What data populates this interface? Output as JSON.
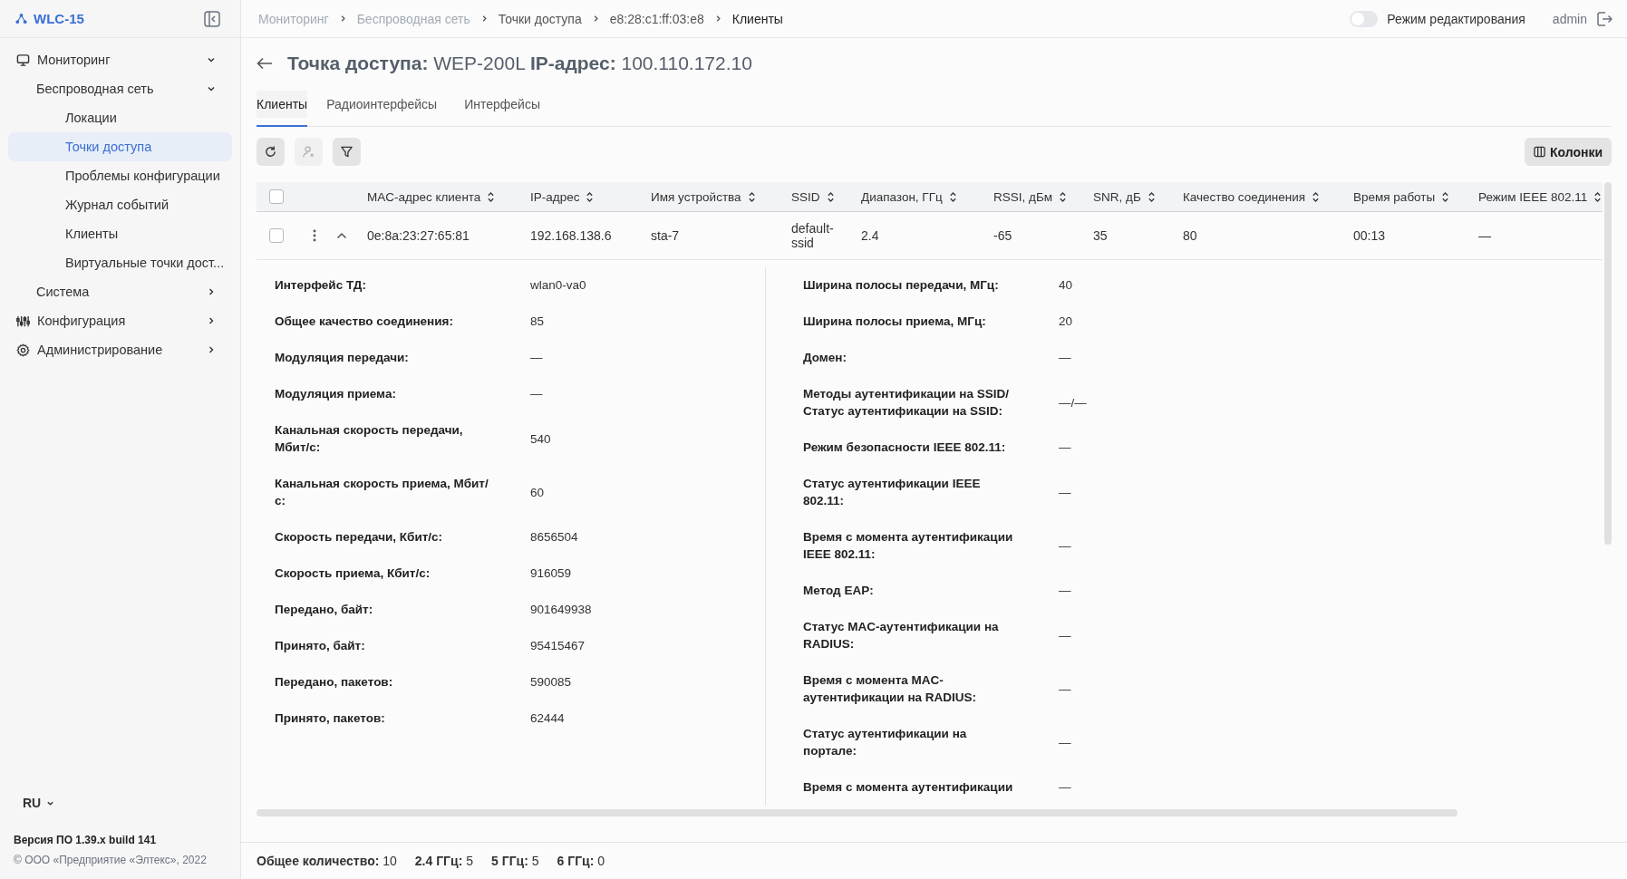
{
  "app": {
    "name": "WLC-15"
  },
  "sidebar": {
    "items": [
      {
        "label": "Мониторинг",
        "expanded": true,
        "selected": false,
        "children": [
          {
            "label": "Беспроводная сеть",
            "expanded": true,
            "selected": false,
            "children": [
              {
                "label": "Локации",
                "selected": false
              },
              {
                "label": "Точки доступа",
                "selected": true
              },
              {
                "label": "Проблемы конфигурации",
                "selected": false
              },
              {
                "label": "Журнал событий",
                "selected": false
              },
              {
                "label": "Клиенты",
                "selected": false
              },
              {
                "label": "Виртуальные точки дост...",
                "selected": false
              }
            ]
          },
          {
            "label": "Система",
            "expanded": false,
            "selected": false
          }
        ]
      },
      {
        "label": "Конфигурация",
        "expanded": false,
        "selected": false
      },
      {
        "label": "Администрирование",
        "expanded": false,
        "selected": false
      }
    ]
  },
  "language": "RU",
  "version": "Версия ПО 1.39.x build 141",
  "copyright": "© ООО «Предприятие «Элтекс», 2022",
  "breadcrumbs": [
    {
      "label": "Мониторинг",
      "disabled": true
    },
    {
      "label": "Беспроводная сеть",
      "disabled": true
    },
    {
      "label": "Точки доступа",
      "disabled": false
    },
    {
      "label": "e8:28:c1:ff:03:e8",
      "disabled": false
    },
    {
      "label": "Клиенты",
      "disabled": false
    }
  ],
  "edit_mode": {
    "label": "Режим редактирования",
    "on": false
  },
  "user": "admin",
  "title": "**Точка доступа:** WEP-200L **IP-адрес:** 100.110.172.10",
  "tabs": [
    {
      "label": "Клиенты",
      "selected": true
    },
    {
      "label": "Радиоинтерфейсы",
      "selected": false
    },
    {
      "label": "Интерфейсы",
      "selected": false
    }
  ],
  "toolbar": {
    "buttons": [
      {
        "kind": "refresh",
        "disabled": false
      },
      {
        "kind": "remove-user",
        "disabled": true
      },
      {
        "kind": "filter",
        "disabled": false
      }
    ],
    "columns_button": "Колонки"
  },
  "table": {
    "all_checked": false,
    "columns": [
      "MAC-адрес клиента",
      "IP-адрес",
      "Имя устройства",
      "SSID",
      "Диапазон, ГГц",
      "RSSI, дБм",
      "SNR, дБ",
      "Качество соединения",
      "Время работы",
      "Режим IEEE 802.11"
    ],
    "rows": [
      {
        "checked": false,
        "expanded": true,
        "cells": [
          "0e:8a:23:27:65:81",
          "192.168.138.6",
          "sta-7",
          "default-ssid",
          "2.4",
          "-65",
          "35",
          "80",
          "00:13",
          "—"
        ]
      }
    ]
  },
  "details": {
    "left": [
      {
        "label": "Интерфейс ТД:",
        "value": "wlan0-va0"
      },
      {
        "label": "Общее качество соединения:",
        "value": "85"
      },
      {
        "label": "Модуляция передачи:",
        "value": "—"
      },
      {
        "label": "Модуляция приема:",
        "value": "—"
      },
      {
        "label": "Канальная скорость передачи, Мбит/с:",
        "value": "540"
      },
      {
        "label": "Канальная скорость приема, Мбит/с:",
        "value": "60"
      },
      {
        "label": "Скорость передачи, Кбит/с:",
        "value": "8656504"
      },
      {
        "label": "Скорость приема, Кбит/с:",
        "value": "916059"
      },
      {
        "label": "Передано, байт:",
        "value": "901649938"
      },
      {
        "label": "Принято, байт:",
        "value": "95415467"
      },
      {
        "label": "Передано, пакетов:",
        "value": "590085"
      },
      {
        "label": "Принято, пакетов:",
        "value": "62444"
      }
    ],
    "right": [
      {
        "label": "Ширина полосы передачи, МГц:",
        "value": "40"
      },
      {
        "label": "Ширина полосы приема, МГц:",
        "value": "20"
      },
      {
        "label": "Домен:",
        "value": "—"
      },
      {
        "label": "Методы аутентификации на SSID/ Статус аутентификации на SSID:",
        "value": "—/—"
      },
      {
        "label": "Режим безопасности IEEE 802.11:",
        "value": "—"
      },
      {
        "label": "Статус аутентификации IEEE 802.11:",
        "value": "—"
      },
      {
        "label": "Время с момента аутентификации IEEE 802.11:",
        "value": "—"
      },
      {
        "label": "Метод EAP:",
        "value": "—"
      },
      {
        "label": "Статус MAC-аутентификации на RADIUS:",
        "value": "—"
      },
      {
        "label": "Время с момента MAC-аутентификации на RADIUS:",
        "value": "—"
      },
      {
        "label": "Статус аутентификации на портале:",
        "value": "—"
      },
      {
        "label": "Время с момента аутентификации",
        "value": "—"
      }
    ]
  },
  "footer": [
    "**Общее количество:** 10",
    "**2.4 ГГц:** 5",
    "**5 ГГц:** 5",
    "**6 ГГц:** 0"
  ]
}
